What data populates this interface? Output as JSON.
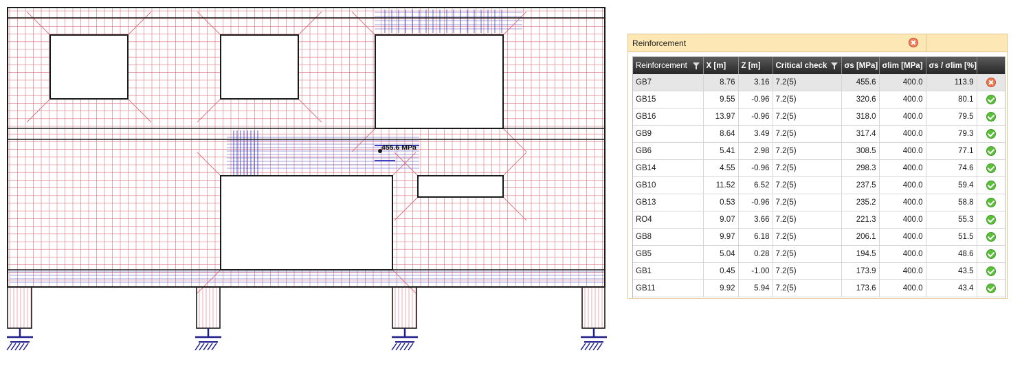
{
  "model": {
    "stress_label": "455.6 MPa"
  },
  "panel": {
    "title": "Reinforcement",
    "close_icon": "close-icon",
    "columns": [
      {
        "label": "Reinforcement",
        "filter": true
      },
      {
        "label": "X [m]",
        "filter": false
      },
      {
        "label": "Z [m]",
        "filter": false
      },
      {
        "label": "Critical check",
        "filter": true
      },
      {
        "label": "σs [MPa]",
        "filter": false
      },
      {
        "label": "σlim [MPa]",
        "filter": false
      },
      {
        "label": "σs / σlim [%]",
        "filter": false
      },
      {
        "label": "",
        "filter": false
      }
    ],
    "rows": [
      {
        "name": "GB7",
        "x": "8.76",
        "z": "3.16",
        "check": "7.2(5)",
        "sigma_s": "455.6",
        "sigma_lim": "400.0",
        "ratio": "113.9",
        "status": "fail"
      },
      {
        "name": "GB15",
        "x": "9.55",
        "z": "-0.96",
        "check": "7.2(5)",
        "sigma_s": "320.6",
        "sigma_lim": "400.0",
        "ratio": "80.1",
        "status": "ok"
      },
      {
        "name": "GB16",
        "x": "13.97",
        "z": "-0.96",
        "check": "7.2(5)",
        "sigma_s": "318.0",
        "sigma_lim": "400.0",
        "ratio": "79.5",
        "status": "ok"
      },
      {
        "name": "GB9",
        "x": "8.64",
        "z": "3.49",
        "check": "7.2(5)",
        "sigma_s": "317.4",
        "sigma_lim": "400.0",
        "ratio": "79.3",
        "status": "ok"
      },
      {
        "name": "GB6",
        "x": "5.41",
        "z": "2.98",
        "check": "7.2(5)",
        "sigma_s": "308.5",
        "sigma_lim": "400.0",
        "ratio": "77.1",
        "status": "ok"
      },
      {
        "name": "GB14",
        "x": "4.55",
        "z": "-0.96",
        "check": "7.2(5)",
        "sigma_s": "298.3",
        "sigma_lim": "400.0",
        "ratio": "74.6",
        "status": "ok"
      },
      {
        "name": "GB10",
        "x": "11.52",
        "z": "6.52",
        "check": "7.2(5)",
        "sigma_s": "237.5",
        "sigma_lim": "400.0",
        "ratio": "59.4",
        "status": "ok"
      },
      {
        "name": "GB13",
        "x": "0.53",
        "z": "-0.96",
        "check": "7.2(5)",
        "sigma_s": "235.2",
        "sigma_lim": "400.0",
        "ratio": "58.8",
        "status": "ok"
      },
      {
        "name": "RO4",
        "x": "9.07",
        "z": "3.66",
        "check": "7.2(5)",
        "sigma_s": "221.3",
        "sigma_lim": "400.0",
        "ratio": "55.3",
        "status": "ok"
      },
      {
        "name": "GB8",
        "x": "9.97",
        "z": "6.18",
        "check": "7.2(5)",
        "sigma_s": "206.1",
        "sigma_lim": "400.0",
        "ratio": "51.5",
        "status": "ok"
      },
      {
        "name": "GB5",
        "x": "5.04",
        "z": "0.28",
        "check": "7.2(5)",
        "sigma_s": "194.5",
        "sigma_lim": "400.0",
        "ratio": "48.6",
        "status": "ok"
      },
      {
        "name": "GB1",
        "x": "0.45",
        "z": "-1.00",
        "check": "7.2(5)",
        "sigma_s": "173.9",
        "sigma_lim": "400.0",
        "ratio": "43.5",
        "status": "ok"
      },
      {
        "name": "GB11",
        "x": "9.92",
        "z": "5.94",
        "check": "7.2(5)",
        "sigma_s": "173.6",
        "sigma_lim": "400.0",
        "ratio": "43.4",
        "status": "ok"
      }
    ],
    "selected_row": 0
  },
  "colors": {
    "rebar_red": "#d9707c",
    "rebar_blue": "#4040c0",
    "outline": "#1a1a1a",
    "support": "#1e1e8a",
    "header_bg": "#fde7b4"
  }
}
